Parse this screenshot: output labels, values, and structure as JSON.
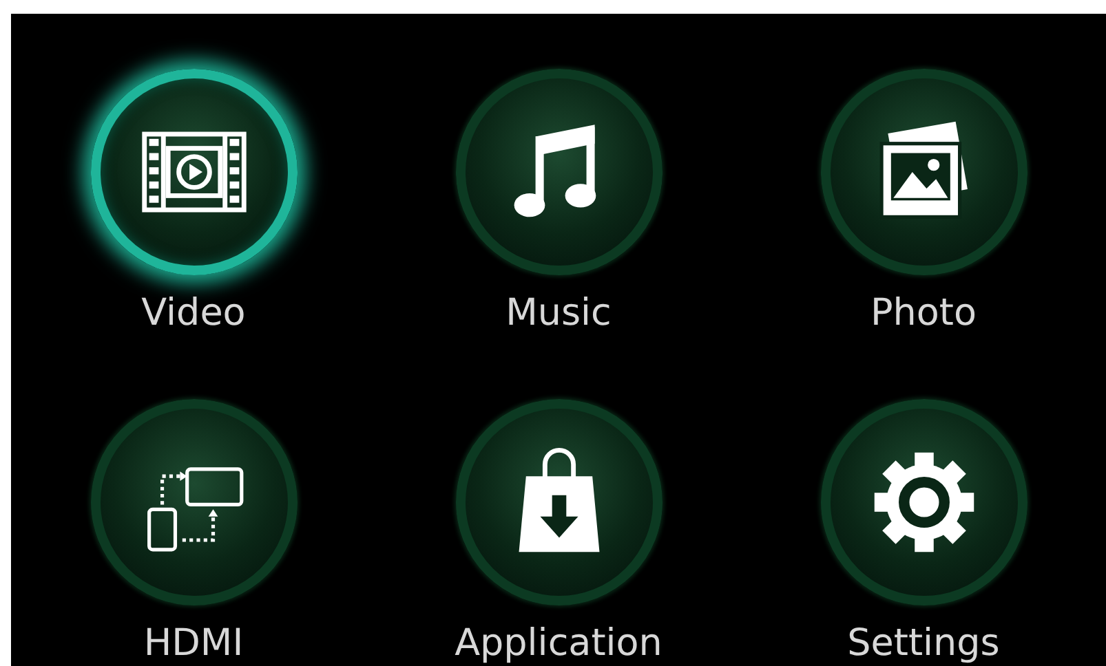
{
  "menu": [
    {
      "label": "Video",
      "kind": "video",
      "selected": true
    },
    {
      "label": "Music",
      "kind": "music",
      "selected": false
    },
    {
      "label": "Photo",
      "kind": "photo",
      "selected": false
    },
    {
      "label": "HDMI",
      "kind": "hdmi",
      "selected": false
    },
    {
      "label": "Application",
      "kind": "app",
      "selected": false
    },
    {
      "label": "Settings",
      "kind": "settings",
      "selected": false
    }
  ]
}
